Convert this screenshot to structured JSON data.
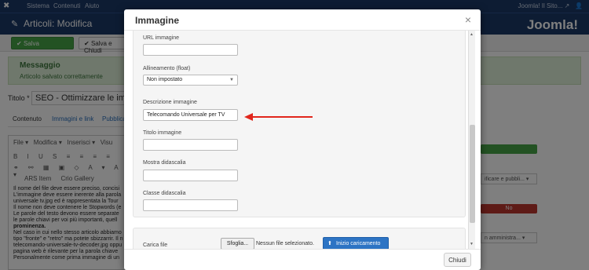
{
  "topbar": {
    "menu": [
      "Sistema",
      "Contenuti",
      "Aiuto"
    ],
    "site_link": "Joomla! Il Sito..."
  },
  "header": {
    "title": "Articoli: Modifica",
    "logo": "Joomla!"
  },
  "toolbar": {
    "save": "Salva",
    "save_close": "Salva e Chiudi"
  },
  "message": {
    "heading": "Messaggio",
    "text": "Articolo salvato correttamente"
  },
  "article": {
    "title_label": "Titolo *",
    "title_value": "SEO - Ottimizzare le imm"
  },
  "tabs": [
    "Contenuto",
    "Immagini e link",
    "Pubblica"
  ],
  "editor": {
    "menus": [
      "File",
      "Modifica",
      "Inserisci",
      "Visu"
    ],
    "buttons_row": [
      "ARS Item",
      "Crio Gallery"
    ],
    "text_lines": [
      "Il nome del file deve essere preciso, concisi",
      "L'immagine deve essere inerente alla parola",
      "universale tv.jpg ed è rappresentata la Tour",
      "Il nome non deve contenere le Stopwords (e",
      "Le parole del testo devono essere separate",
      "le parole chiavi per voi più importanti, quell",
      "prominenza.",
      "Nel caso in cui nello stesso articolo abbiamo",
      "tipo \"fronte\" e \"retro\" ma potete sbizzarrir. Il n",
      "telecomando-universale-tv-decoder.jpg oppu",
      "pagina web è rilevante per la parola chiave",
      "Personalmente come prima immagine di un"
    ]
  },
  "sidepanel": {
    "select1": "ificare e pubbli...",
    "no_label": "No",
    "select2": "n amministra..."
  },
  "modal": {
    "title": "Immagine",
    "close_symbol": "×",
    "fields": {
      "url_label": "URL immagine",
      "url_value": "",
      "align_label": "Allineamento (float)",
      "align_value": "Non impostato",
      "desc_label": "Descrizione immagine",
      "desc_value": "Telecomando Universale per TV",
      "title_label": "Titolo immagine",
      "title_value": "",
      "caption_label": "Mostra didascalia",
      "caption_value": "",
      "caption_class_label": "Classe didascalia",
      "caption_class_value": ""
    },
    "upload": {
      "label": "Carica file",
      "browse": "Sfoglia...",
      "no_file": "Nessun file selezionato.",
      "start": "Inizio caricamento"
    },
    "footer_close": "Chiudi"
  },
  "colors": {
    "arrow": "#e1261c",
    "primary": "#2d74c4",
    "joomla_blue": "#1a3867",
    "success": "#46a546"
  },
  "icons": {
    "upload": "upload-icon",
    "close": "close-icon"
  }
}
